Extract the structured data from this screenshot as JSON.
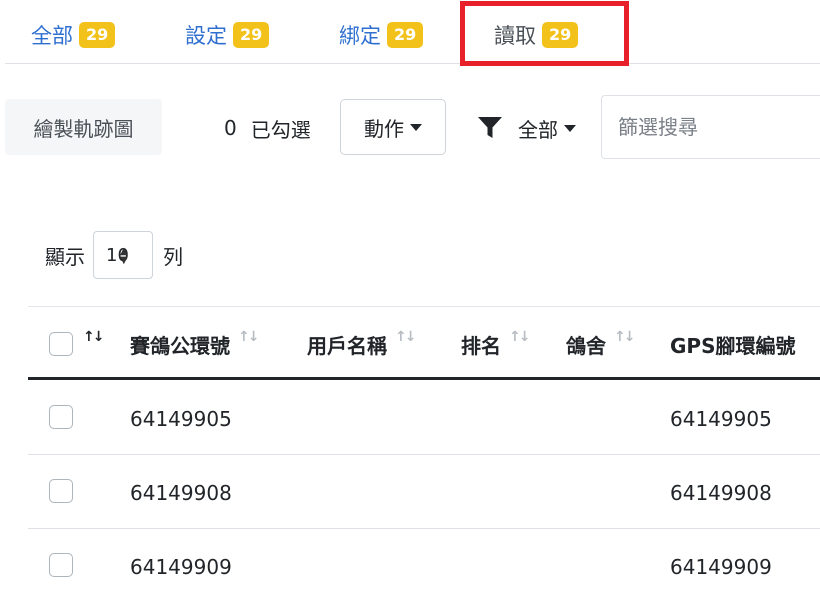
{
  "tabs": [
    {
      "label": "全部",
      "count": "29"
    },
    {
      "label": "設定",
      "count": "29"
    },
    {
      "label": "綁定",
      "count": "29"
    },
    {
      "label": "讀取",
      "count": "29"
    }
  ],
  "toolbar": {
    "trace_button": "繪製軌跡圖",
    "checked_count": "0",
    "checked_label": "已勾選",
    "action_button": "動作",
    "filter_label": "全部",
    "search_placeholder": "篩選搜尋"
  },
  "pagesize": {
    "prefix": "顯示",
    "value": "10",
    "suffix": "列"
  },
  "table": {
    "columns": [
      "賽鴿公環號",
      "用戶名稱",
      "排名",
      "鴿舍",
      "GPS腳環編號"
    ],
    "rows": [
      {
        "ring": "64149905",
        "user": "",
        "rank": "",
        "loft": "",
        "gps": "64149905"
      },
      {
        "ring": "64149908",
        "user": "",
        "rank": "",
        "loft": "",
        "gps": "64149908"
      },
      {
        "ring": "64149909",
        "user": "",
        "rank": "",
        "loft": "",
        "gps": "64149909"
      }
    ]
  },
  "colors": {
    "tab_link": "#2f6fd0",
    "badge": "#f2c21a",
    "highlight": "#e8202a"
  }
}
